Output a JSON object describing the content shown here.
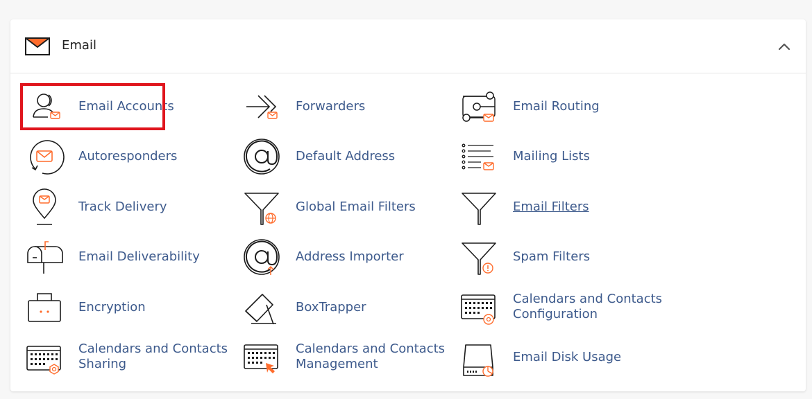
{
  "section": {
    "title": "Email",
    "collapse_icon": "chevron-up-icon",
    "header_icon": "envelope-icon"
  },
  "colors": {
    "accent_orange": "#ff6c2c",
    "link_blue": "#3d5a8c",
    "highlight_red": "#e0151d",
    "icon_dark": "#1c1c1c"
  },
  "items": [
    {
      "label": "Email Accounts",
      "icon": "user-email-icon",
      "highlighted": true
    },
    {
      "label": "Forwarders",
      "icon": "forward-arrow-icon"
    },
    {
      "label": "Email Routing",
      "icon": "routing-icon"
    },
    {
      "label": "Autoresponders",
      "icon": "autoresponder-icon"
    },
    {
      "label": "Default Address",
      "icon": "at-sign-icon"
    },
    {
      "label": "Mailing Lists",
      "icon": "mailing-list-icon"
    },
    {
      "label": "Track Delivery",
      "icon": "location-pin-email-icon"
    },
    {
      "label": "Global Email Filters",
      "icon": "filter-globe-icon"
    },
    {
      "label": "Email Filters",
      "icon": "filter-icon",
      "underlined": true
    },
    {
      "label": "Email Deliverability",
      "icon": "mailbox-icon"
    },
    {
      "label": "Address Importer",
      "icon": "at-import-icon"
    },
    {
      "label": "Spam Filters",
      "icon": "filter-alert-icon"
    },
    {
      "label": "Encryption",
      "icon": "briefcase-lock-icon"
    },
    {
      "label": "BoxTrapper",
      "icon": "box-trap-icon"
    },
    {
      "label": "Calendars and Contacts Configuration",
      "icon": "calendar-at-icon"
    },
    {
      "label": "Calendars and Contacts Sharing",
      "icon": "calendar-gear-icon"
    },
    {
      "label": "Calendars and Contacts Management",
      "icon": "calendar-cursor-icon"
    },
    {
      "label": "Email Disk Usage",
      "icon": "disk-usage-icon"
    }
  ]
}
